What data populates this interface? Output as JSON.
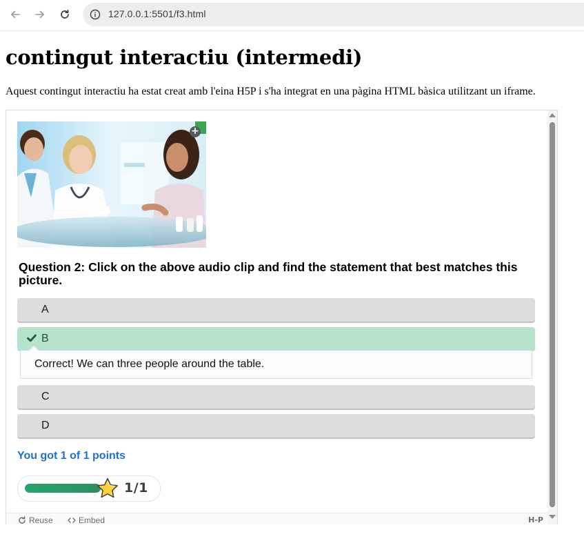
{
  "browser": {
    "url": "127.0.0.1:5501/f3.html",
    "icons": {
      "back": "arrow-left-icon",
      "forward": "arrow-right-icon",
      "reload": "reload-icon",
      "info": "info-icon"
    }
  },
  "page": {
    "title": "contingut interactiu (intermedi)",
    "intro": "Aquest contingut interactiu ha estat creat amb l'eina H5P i s'ha integrat en una pàgina HTML bàsica utilitzant un iframe."
  },
  "h5p": {
    "image_expand_label": "+",
    "question": "Question 2: Click on the above audio clip and find the statement that best matches this picture.",
    "answers": [
      {
        "label": "A",
        "state": "unselected"
      },
      {
        "label": "B",
        "state": "correct"
      },
      {
        "label": "C",
        "state": "unselected"
      },
      {
        "label": "D",
        "state": "unselected"
      }
    ],
    "feedback": "Correct! We can three people around the table.",
    "score_text": "You got 1 of 1 points",
    "score_display": "1/1",
    "score_progress": 1.0,
    "footer": {
      "reuse": "Reuse",
      "embed": "Embed",
      "logo": "H-P"
    }
  },
  "colors": {
    "correct_bg": "#b5e3cb",
    "answer_bg": "#dddddd",
    "score_blue": "#1a73d1",
    "progress_green": "#2e8f5f",
    "star_yellow": "#ffd23b"
  }
}
